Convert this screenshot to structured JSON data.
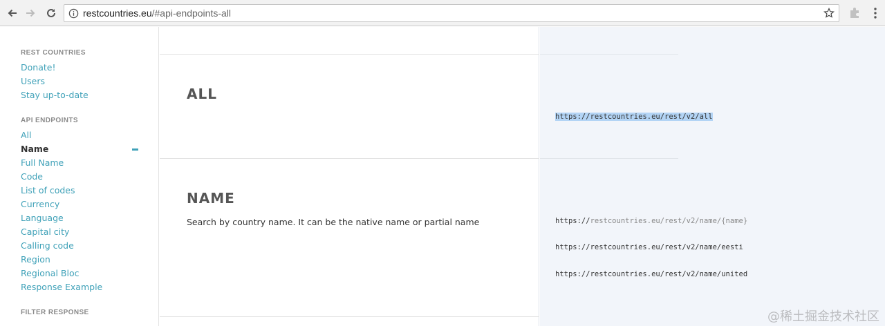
{
  "browser": {
    "url_host": "restcountries.eu",
    "url_rest": "/#api-endpoints-all"
  },
  "sidebar": {
    "headings": [
      "REST COUNTRIES",
      "API ENDPOINTS",
      "FILTER RESPONSE"
    ],
    "rest_countries_items": [
      "Donate!",
      "Users",
      "Stay up-to-date"
    ],
    "api_endpoint_items": [
      "All",
      "Name",
      "Full Name",
      "Code",
      "List of codes",
      "Currency",
      "Language",
      "Capital city",
      "Calling code",
      "Region",
      "Regional Bloc",
      "Response Example"
    ],
    "active_item": "Name"
  },
  "sections": {
    "all": {
      "title": "ALL",
      "url": "https://restcountries.eu/rest/v2/all"
    },
    "name": {
      "title": "NAME",
      "description": "Search by country name. It can be the native name or partial name",
      "url_template_prefix": "https://",
      "url_template_rest": "restcountries.eu/rest/v2/name/{name}",
      "examples": [
        "https://restcountries.eu/rest/v2/name/eesti",
        "https://restcountries.eu/rest/v2/name/united"
      ]
    }
  },
  "watermark": "@稀土掘金技术社区",
  "colors": {
    "link": "#3fa1b8",
    "code_bg": "#f2f5fa",
    "highlight": "#b3d4f5"
  }
}
